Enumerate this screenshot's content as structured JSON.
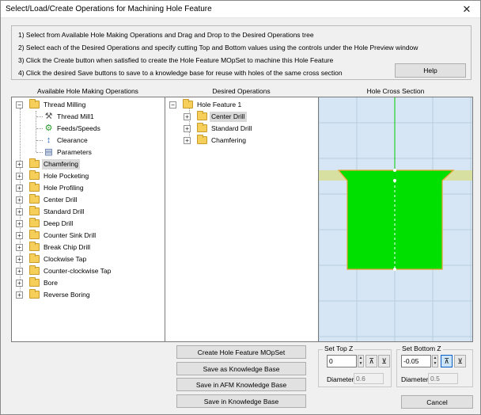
{
  "window": {
    "title": "Select/Load/Create Operations for Machining Hole Feature",
    "close_glyph": "✕"
  },
  "instructions": {
    "lines": [
      "1)  Select from Available Hole Making Operations and Drag and Drop to the Desired Operations tree",
      "2)  Select each of the Desired Operations and specify cutting Top and Bottom values using the controls under the Hole Preview window",
      "3)  Click the Create button when satisfied to create the Hole Feature MOpSet to machine this Hole Feature",
      "4) Click the desired Save buttons to save to a knowledge base for reuse with holes of the same cross section"
    ],
    "help_label": "Help"
  },
  "headers": {
    "available": "Available Hole Making Operations",
    "desired": "Desired Operations",
    "cross_section": "Hole Cross Section"
  },
  "available_tree": {
    "root": {
      "label": "Thread Milling",
      "expander": "−"
    },
    "children": [
      {
        "label": "Thread Mill1",
        "icon": "tool-icon",
        "glyph": "⚒"
      },
      {
        "label": "Feeds/Speeds",
        "icon": "feeds-icon",
        "glyph": "⚙"
      },
      {
        "label": "Clearance",
        "icon": "clearance-icon",
        "glyph": "↕"
      },
      {
        "label": "Parameters",
        "icon": "parameters-icon",
        "glyph": "▤"
      }
    ],
    "items": [
      {
        "label": "Chamfering",
        "expander": "+",
        "selected": true
      },
      {
        "label": "Hole Pocketing",
        "expander": "+"
      },
      {
        "label": "Hole Profiling",
        "expander": "+"
      },
      {
        "label": "Center Drill",
        "expander": "+"
      },
      {
        "label": "Standard Drill",
        "expander": "+"
      },
      {
        "label": "Deep Drill",
        "expander": "+"
      },
      {
        "label": "Counter Sink Drill",
        "expander": "+"
      },
      {
        "label": "Break Chip Drill",
        "expander": "+"
      },
      {
        "label": "Clockwise Tap",
        "expander": "+"
      },
      {
        "label": "Counter-clockwise Tap",
        "expander": "+"
      },
      {
        "label": "Bore",
        "expander": "+"
      },
      {
        "label": "Reverse Boring",
        "expander": "+"
      }
    ]
  },
  "desired_tree": {
    "root": {
      "label": "Hole Feature 1",
      "expander": "−"
    },
    "items": [
      {
        "label": "Center Drill",
        "expander": "+",
        "selected": true
      },
      {
        "label": "Standard Drill",
        "expander": "+"
      },
      {
        "label": "Chamfering",
        "expander": "+"
      }
    ]
  },
  "cross_section": {
    "background_color": "#d6e6f5",
    "grid_color": "#b8cde0",
    "axis_color": "#00cc00",
    "hole_fill": "#00e000",
    "hole_stroke": "#e8a030",
    "chamfer_band_color": "#d7e0a0"
  },
  "actions": {
    "create": "Create Hole Feature MOpSet",
    "save_kb": "Save as Knowledge Base",
    "save_afm": "Save in AFM Knowledge Base",
    "save_in_kb": "Save in Knowledge Base"
  },
  "top_z": {
    "label": "Set Top Z",
    "value": "0",
    "diameter_label": "Diameter:",
    "diameter_value": "0.6"
  },
  "bottom_z": {
    "label": "Set Bottom Z",
    "value": "-0.05",
    "diameter_label": "Diameter:",
    "diameter_value": "0.5"
  },
  "cancel_label": "Cancel"
}
